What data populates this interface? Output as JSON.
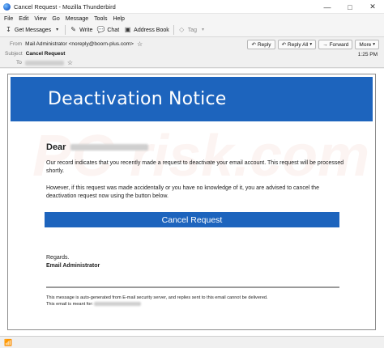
{
  "window": {
    "title": "Cancel Request - Mozilla Thunderbird",
    "minimize_icon": "minimize-icon",
    "maximize_icon": "maximize-icon",
    "close_icon": "close-icon"
  },
  "menubar": {
    "items": [
      "File",
      "Edit",
      "View",
      "Go",
      "Message",
      "Tools",
      "Help"
    ]
  },
  "toolbar": {
    "get_messages": "Get Messages",
    "write": "Write",
    "chat": "Chat",
    "address_book": "Address Book",
    "tag": "Tag"
  },
  "header": {
    "from_label": "From",
    "from_value": "Mail Administrator <noreply@boorn-plus.com>",
    "subject_label": "Subject",
    "subject_value": "Cancel Request",
    "to_label": "To",
    "time": "1:25 PM",
    "reply": "Reply",
    "reply_all": "Reply All",
    "forward": "Forward",
    "more": "More"
  },
  "email": {
    "banner_title": "Deactivation Notice",
    "greeting": "Dear",
    "paragraph1": "Our record indicates that you recently made a request to deactivate your email account. This request will be processed shortly.",
    "paragraph2": "However, if this request was made accidentally or you have no knowledge of it, you are advised to cancel the deactivation request now using the button below.",
    "button_label": "Cancel Request",
    "regards": "Regards.",
    "signature": "Email Administrator",
    "footer_line1": "This message is auto-generated from E-mail security server, and replies sent to this email cannot be delivered.",
    "footer_line2": "This email is meant for:"
  },
  "colors": {
    "banner": "#1d64bd",
    "button": "#1d64bd"
  }
}
